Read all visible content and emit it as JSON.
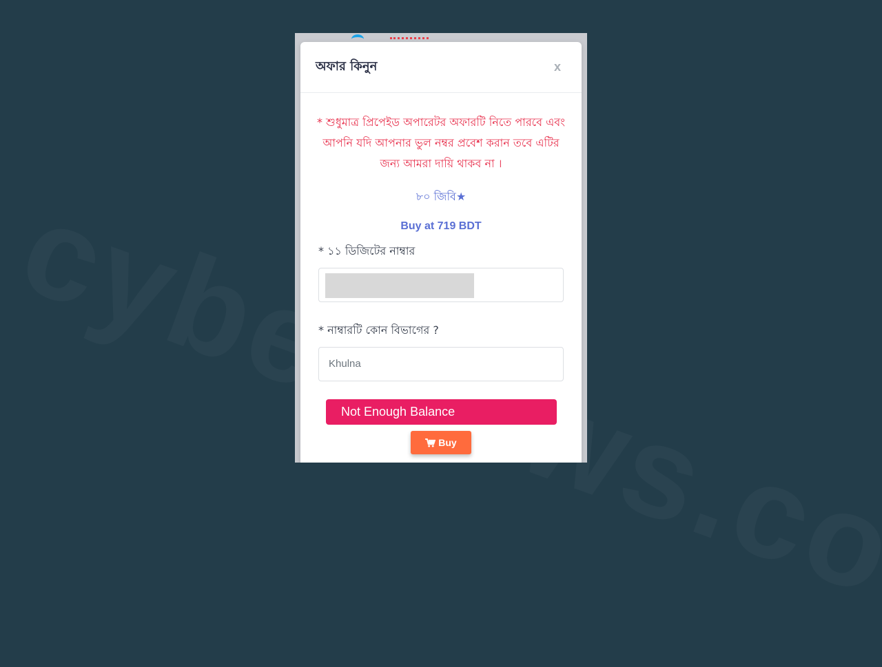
{
  "watermark": "cybernews.com",
  "modal": {
    "title": "অফার কিনুন",
    "close_label": "x"
  },
  "offer": {
    "warning": "* শুধুমাত্র প্রিপেইড অপারেটর অফারটি নিতে পারবে এবং আপনি যদি আপনার ভুল নম্বর প্রবেশ করান তবে এটির জন্য আমরা দায়ি থাকব না ।",
    "plan_name": "৮০ জিবি★",
    "price": "Buy at 719 BDT"
  },
  "form": {
    "number_label": "* ১১ ডিজিটের নাম্বার",
    "division_label": "* নাম্বারটি কোন বিভাগের ?",
    "division_value": "Khulna"
  },
  "actions": {
    "balance_label": "Not Enough Balance",
    "buy_label": "Buy"
  },
  "icons": {
    "cart": "cart-icon"
  },
  "colors": {
    "warning": "#e8334f",
    "accent": "#5a6fd4",
    "balance_button": "#e91e63",
    "buy_button": "#ff6b3d"
  }
}
